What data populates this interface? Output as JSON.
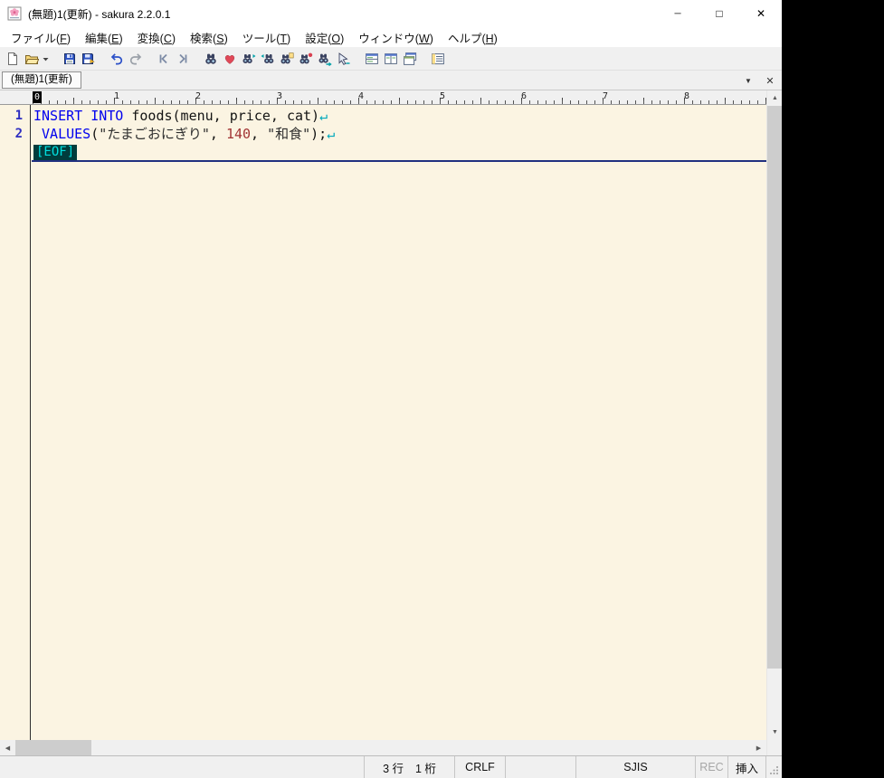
{
  "window": {
    "title": "(無題)1(更新) - sakura 2.2.0.1",
    "controls": {
      "minimize": "─",
      "maximize": "□",
      "close": "✕"
    }
  },
  "menubar": {
    "items": [
      {
        "label": "ファイル(F)"
      },
      {
        "label": "編集(E)"
      },
      {
        "label": "変換(C)"
      },
      {
        "label": "検索(S)"
      },
      {
        "label": "ツール(T)"
      },
      {
        "label": "設定(O)"
      },
      {
        "label": "ウィンドウ(W)"
      },
      {
        "label": "ヘルプ(H)"
      }
    ]
  },
  "toolbar": {
    "buttons": [
      "new-file",
      "open-file",
      "open-file-dropdown",
      "save",
      "save-as",
      "undo",
      "redo",
      "history-back",
      "history-forward",
      "find",
      "replace",
      "find-next",
      "find-prev",
      "grep",
      "bookmark",
      "jump",
      "tag-jump",
      "split-window-h",
      "split-window-v",
      "new-window",
      "outline"
    ]
  },
  "tabbar": {
    "tabs": [
      {
        "label": "(無題)1(更新)",
        "active": true
      }
    ],
    "dropdown_glyph": "▼",
    "close_glyph": "✕"
  },
  "ruler": {
    "origin": "0",
    "numbers": [
      "1",
      "2",
      "3",
      "4",
      "5",
      "6",
      "7",
      "8"
    ]
  },
  "editor": {
    "lines": [
      {
        "number": "1",
        "tokens": [
          {
            "t": "INSERT",
            "c": "keyword"
          },
          {
            "t": " ",
            "c": "plain"
          },
          {
            "t": "INTO",
            "c": "keyword"
          },
          {
            "t": " foods(menu, price, cat)",
            "c": "plain"
          },
          {
            "t": "↵",
            "c": "newline"
          }
        ]
      },
      {
        "number": "2",
        "tokens": [
          {
            "t": " ",
            "c": "plain"
          },
          {
            "t": "VALUES",
            "c": "keyword"
          },
          {
            "t": "(",
            "c": "plain"
          },
          {
            "t": "\"たまごおにぎり\"",
            "c": "string"
          },
          {
            "t": ", ",
            "c": "plain"
          },
          {
            "t": "140",
            "c": "number"
          },
          {
            "t": ", ",
            "c": "plain"
          },
          {
            "t": "\"和食\"",
            "c": "string"
          },
          {
            "t": ");",
            "c": "plain"
          },
          {
            "t": "↵",
            "c": "newline"
          }
        ]
      }
    ],
    "eof_marker": "[EOF]"
  },
  "scrollbar": {
    "up": "▲",
    "down": "▼",
    "left": "◀",
    "right": "▶"
  },
  "statusbar": {
    "message": "",
    "caret_line": "3 行",
    "caret_column": "1 桁",
    "line_ending": "CRLF",
    "extra": "",
    "encoding": "SJIS",
    "macro_record": "REC",
    "insert_mode": "挿入"
  },
  "colors": {
    "editor_background": "#fbf4e2",
    "keyword": "#0000ee",
    "string": "#2e2e2e",
    "number": "#a23535",
    "newline_mark": "#00a8bc",
    "eof_background": "#003d3d",
    "eof_text": "#00dede",
    "line_number": "#2d2dc0",
    "cursor_line_underline": "#20307f"
  }
}
